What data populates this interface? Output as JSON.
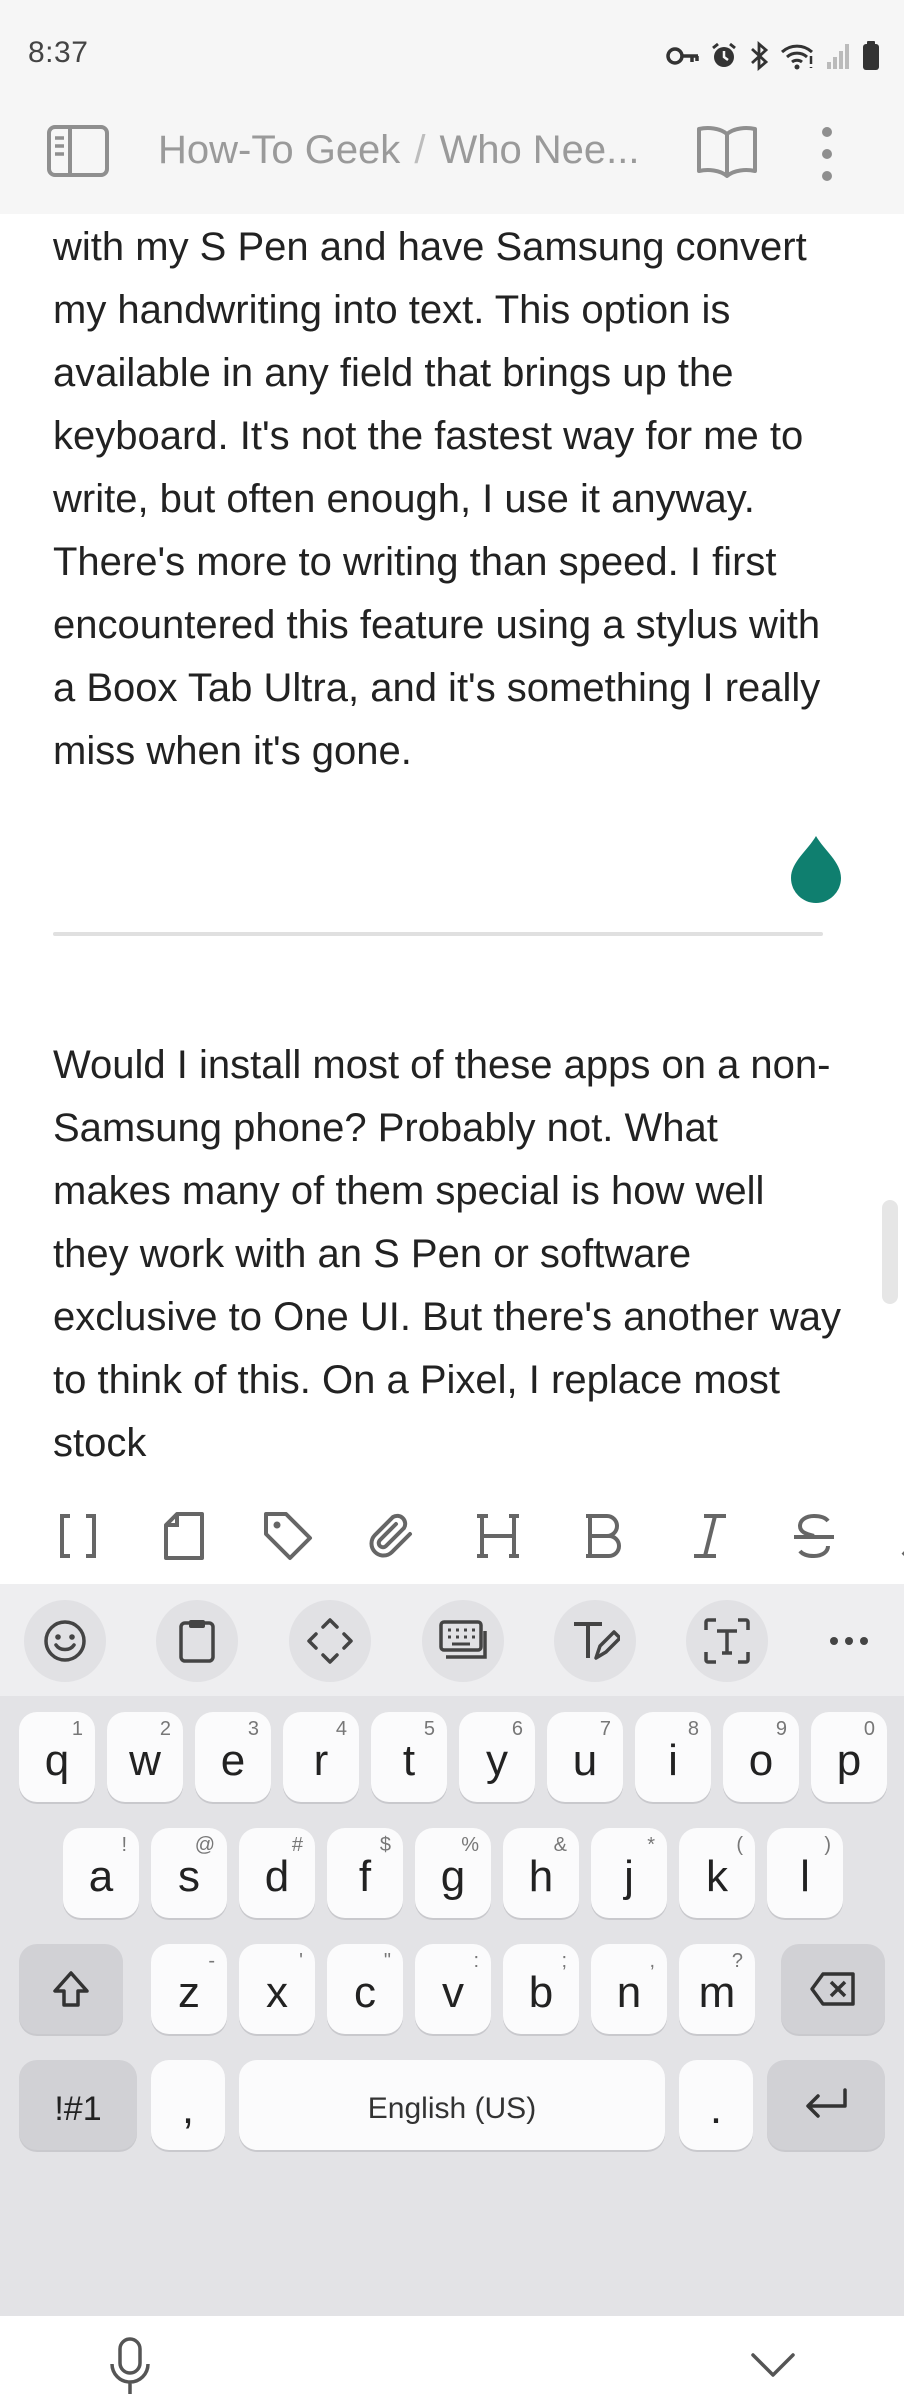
{
  "status_bar": {
    "time": "8:37",
    "icons": [
      "key-icon",
      "alarm-icon",
      "bluetooth-icon",
      "wifi-icon",
      "signal-icon",
      "battery-icon"
    ]
  },
  "app_bar": {
    "breadcrumb_vault": "How-To Geek",
    "breadcrumb_separator": "/",
    "breadcrumb_note": "Who Nee...",
    "icons": [
      "sidebar-toggle-icon",
      "reading-view-icon",
      "more-options-icon"
    ]
  },
  "editor": {
    "paragraph_1": "with my S Pen and have Samsung convert my handwriting into text. This option is available in any field that brings up the keyboard. It's not the fastest way for me to write, but often enough, I use it anyway. There's more to writing than speed. I first encountered this feature using a stylus with a Boox Tab Ultra, and it's something I really miss when it's gone.",
    "paragraph_2": "Would I install most of these apps on a non-Samsung phone? Probably not. What makes many of them special is how well they work with an S Pen or software exclusive to One UI. But there's another way to think of this. On a Pixel, I replace most stock",
    "cursor_color": "#0f7f6f"
  },
  "format_toolbar": {
    "items": [
      {
        "name": "wikilink-button",
        "glyph": "[]"
      },
      {
        "name": "file-button",
        "glyph": ""
      },
      {
        "name": "tag-button",
        "glyph": ""
      },
      {
        "name": "attachment-button",
        "glyph": ""
      },
      {
        "name": "heading-button",
        "glyph": "H"
      },
      {
        "name": "bold-button",
        "glyph": "B"
      },
      {
        "name": "italic-button",
        "glyph": "I"
      },
      {
        "name": "strikethrough-button",
        "glyph": "S"
      }
    ]
  },
  "keyboard": {
    "toolbar_icons": [
      "emoji-icon",
      "clipboard-icon",
      "text-editing-icon",
      "keyboard-mode-icon",
      "handwriting-icon",
      "text-extraction-icon",
      "more-icon"
    ],
    "row1": [
      {
        "k": "q",
        "h": "1"
      },
      {
        "k": "w",
        "h": "2"
      },
      {
        "k": "e",
        "h": "3"
      },
      {
        "k": "r",
        "h": "4"
      },
      {
        "k": "t",
        "h": "5"
      },
      {
        "k": "y",
        "h": "6"
      },
      {
        "k": "u",
        "h": "7"
      },
      {
        "k": "i",
        "h": "8"
      },
      {
        "k": "o",
        "h": "9"
      },
      {
        "k": "p",
        "h": "0"
      }
    ],
    "row2": [
      {
        "k": "a",
        "h": "!"
      },
      {
        "k": "s",
        "h": "@"
      },
      {
        "k": "d",
        "h": "#"
      },
      {
        "k": "f",
        "h": "$"
      },
      {
        "k": "g",
        "h": "%"
      },
      {
        "k": "h",
        "h": "&"
      },
      {
        "k": "j",
        "h": "*"
      },
      {
        "k": "k",
        "h": "("
      },
      {
        "k": "l",
        "h": ")"
      }
    ],
    "row3": [
      {
        "k": "z",
        "h": "-"
      },
      {
        "k": "x",
        "h": "'"
      },
      {
        "k": "c",
        "h": "\""
      },
      {
        "k": "v",
        "h": ":"
      },
      {
        "k": "b",
        "h": ";"
      },
      {
        "k": "n",
        "h": ","
      },
      {
        "k": "m",
        "h": "?"
      }
    ],
    "symbols_label": "!#1",
    "comma_label": ",",
    "space_label": "English (US)",
    "period_label": ".",
    "bottom_icons": [
      "microphone-icon",
      "hide-keyboard-icon"
    ]
  }
}
